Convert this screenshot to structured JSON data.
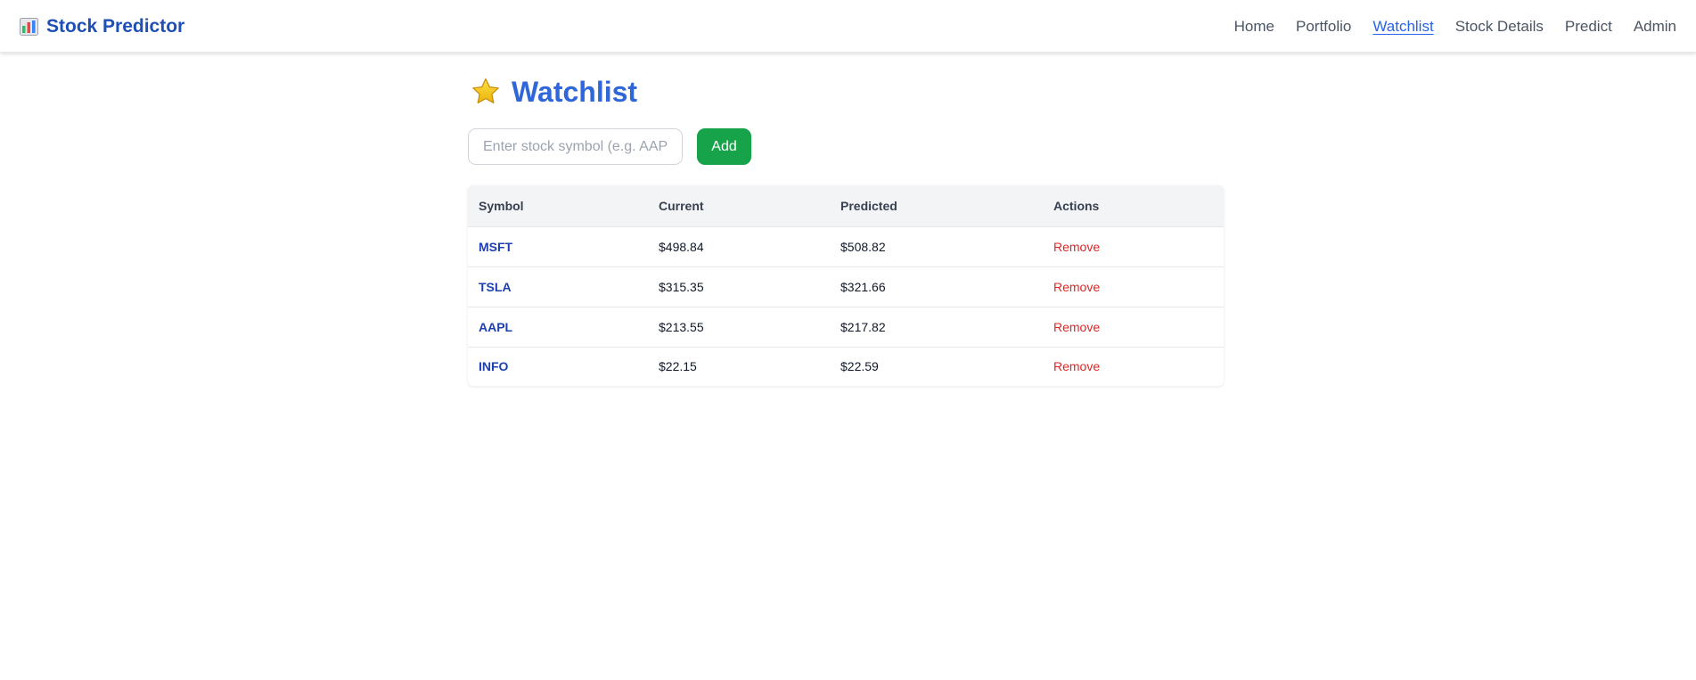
{
  "app": {
    "brand_name": "Stock Predictor",
    "brand_icon": "bar-chart-icon"
  },
  "nav": {
    "items": [
      {
        "label": "Home",
        "active": false
      },
      {
        "label": "Portfolio",
        "active": false
      },
      {
        "label": "Watchlist",
        "active": true
      },
      {
        "label": "Stock Details",
        "active": false
      },
      {
        "label": "Predict",
        "active": false
      },
      {
        "label": "Admin",
        "active": false
      }
    ]
  },
  "page": {
    "title": "Watchlist",
    "title_icon": "star-icon"
  },
  "add_form": {
    "placeholder": "Enter stock symbol (e.g. AAPL)",
    "value": "",
    "button_label": "Add"
  },
  "table": {
    "columns": [
      "Symbol",
      "Current",
      "Predicted",
      "Actions"
    ],
    "rows": [
      {
        "symbol": "MSFT",
        "current": "$498.84",
        "predicted": "$508.82",
        "action": "Remove"
      },
      {
        "symbol": "TSLA",
        "current": "$315.35",
        "predicted": "$321.66",
        "action": "Remove"
      },
      {
        "symbol": "AAPL",
        "current": "$213.55",
        "predicted": "$217.82",
        "action": "Remove"
      },
      {
        "symbol": "INFO",
        "current": "$22.15",
        "predicted": "$22.59",
        "action": "Remove"
      }
    ]
  },
  "colors": {
    "brand": "#1e4fb4",
    "title": "#2f67da",
    "nav_active": "#2563eb",
    "add_button": "#16a34a",
    "remove_link": "#dc2626",
    "symbol_link": "#1e40af",
    "table_header_bg": "#f3f4f6"
  }
}
